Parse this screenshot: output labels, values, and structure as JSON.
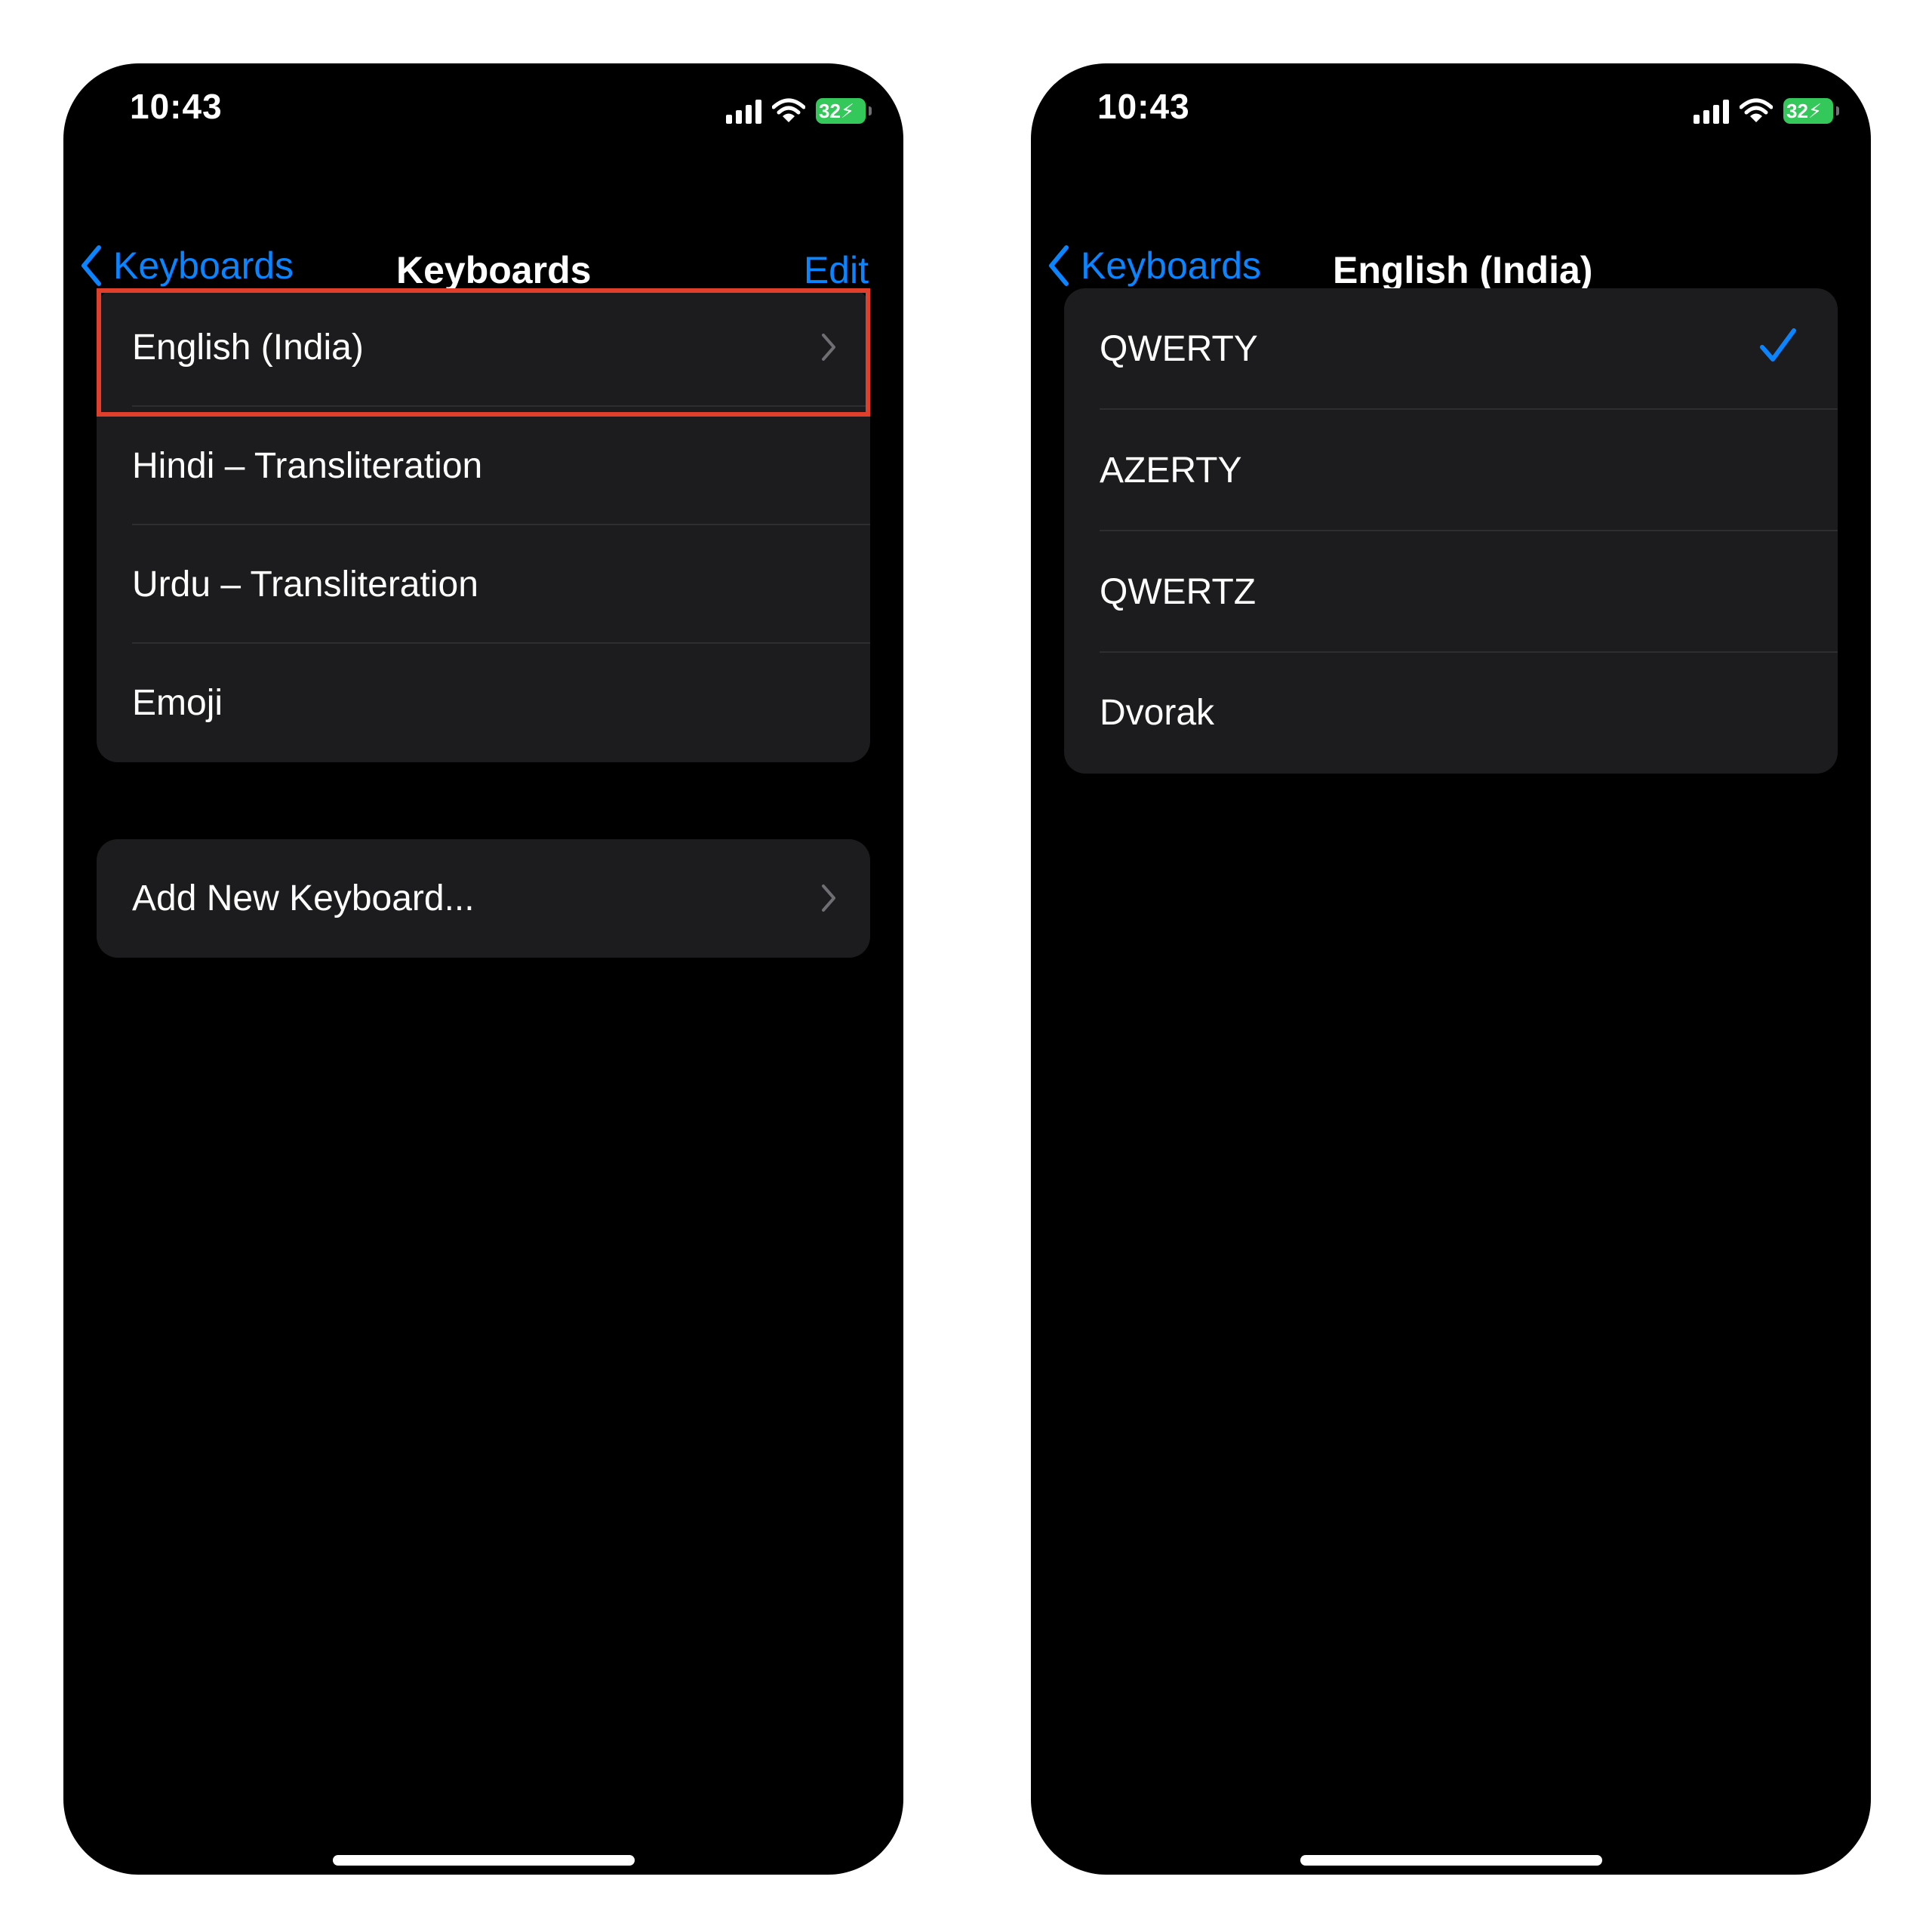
{
  "status_bar": {
    "time": "10:43",
    "battery": "32"
  },
  "left_screen": {
    "nav": {
      "back_label": "Keyboards",
      "title": "Keyboards",
      "edit_label": "Edit"
    },
    "keyboards": [
      {
        "label": "English (India)",
        "has_chevron": true,
        "highlighted": true
      },
      {
        "label": "Hindi – Transliteration"
      },
      {
        "label": "Urdu – Transliteration"
      },
      {
        "label": "Emoji"
      }
    ],
    "add_keyboard_label": "Add New Keyboard..."
  },
  "right_screen": {
    "nav": {
      "back_label": "Keyboards",
      "title": "English (India)"
    },
    "layouts": [
      {
        "label": "QWERTY",
        "selected": true
      },
      {
        "label": "AZERTY"
      },
      {
        "label": "QWERTZ"
      },
      {
        "label": "Dvorak"
      }
    ]
  },
  "colors": {
    "accent": "#0a84ff",
    "highlight_border": "#e0402b",
    "battery": "#34c759",
    "cell_background": "#1c1c1e"
  },
  "icons": [
    "signal-icon",
    "wifi-icon",
    "battery-icon",
    "back-chevron-icon",
    "chevron-right-icon",
    "checkmark-icon"
  ]
}
